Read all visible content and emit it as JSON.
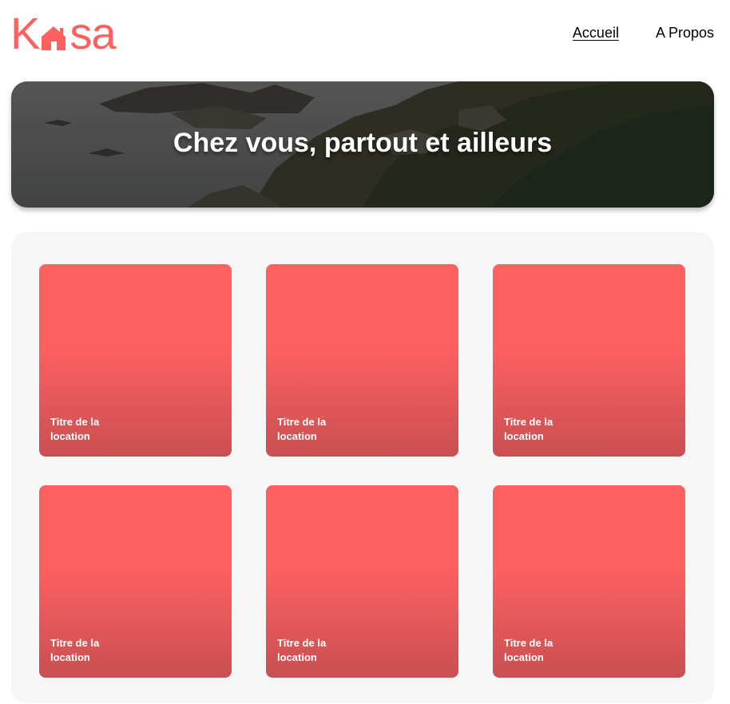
{
  "brand": {
    "logo_k": "K",
    "logo_sa": "sa",
    "color": "#ff6060"
  },
  "nav": {
    "home": "Accueil",
    "about": "A Propos"
  },
  "banner": {
    "title": "Chez vous, partout et ailleurs"
  },
  "cards": [
    {
      "title": "Titre de la location"
    },
    {
      "title": "Titre de la location"
    },
    {
      "title": "Titre de la location"
    },
    {
      "title": "Titre de la location"
    },
    {
      "title": "Titre de la location"
    },
    {
      "title": "Titre de la location"
    }
  ]
}
